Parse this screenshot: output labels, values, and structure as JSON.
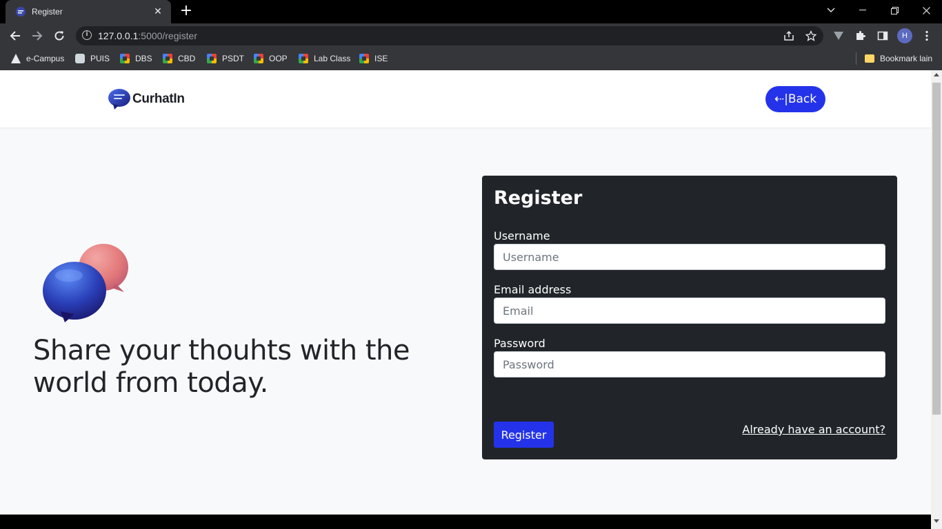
{
  "browser": {
    "tab_title": "Register",
    "url_host": "127.0.0.1",
    "url_path": ":5000/register",
    "profile_initial": "H",
    "bookmarks": [
      {
        "label": "e-Campus",
        "icon": "e-campus-icon"
      },
      {
        "label": "PUIS",
        "icon": "puis-icon"
      },
      {
        "label": "DBS",
        "icon": "classroom-icon"
      },
      {
        "label": "CBD",
        "icon": "classroom-icon"
      },
      {
        "label": "PSDT",
        "icon": "classroom-icon"
      },
      {
        "label": "OOP",
        "icon": "classroom-icon"
      },
      {
        "label": "Lab Class",
        "icon": "classroom-icon"
      },
      {
        "label": "ISE",
        "icon": "classroom-icon"
      }
    ],
    "other_bookmarks": "Bookmark lain"
  },
  "navbar": {
    "brand": "CurhatIn",
    "back_label": "⇠|Back"
  },
  "hero": {
    "tagline": "Share your thouhts with the world from today."
  },
  "form": {
    "title": "Register",
    "username_label": "Username",
    "username_placeholder": "Username",
    "username_value": "",
    "email_label": "Email address",
    "email_placeholder": "Email",
    "email_value": "",
    "password_label": "Password",
    "password_placeholder": "Password",
    "password_value": "",
    "submit_label": "Register",
    "login_link": "Already have an account?"
  },
  "colors": {
    "accent": "#2433ea",
    "card_bg": "#212529",
    "page_bg": "#f8f9fa"
  }
}
